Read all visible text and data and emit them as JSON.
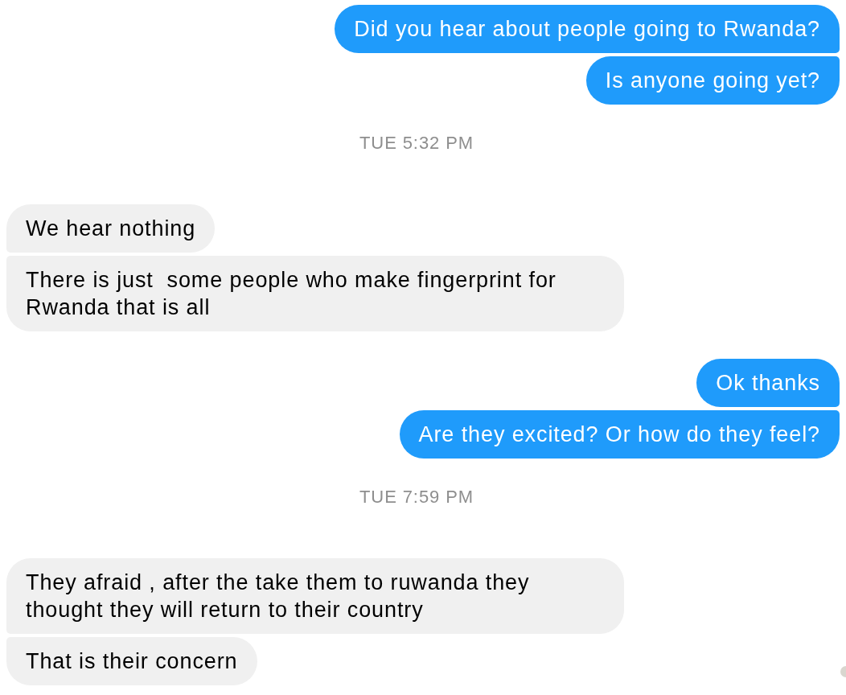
{
  "conversation": [
    {
      "kind": "outgoing",
      "messages": [
        "Did you hear about people going to Rwanda?",
        "Is anyone going yet?"
      ]
    },
    {
      "kind": "timestamp",
      "text": "TUE 5:32 PM"
    },
    {
      "kind": "incoming",
      "messages": [
        "We hear nothing",
        "There is just  some people who make fingerprint for Rwanda that is all"
      ]
    },
    {
      "kind": "outgoing",
      "messages": [
        "Ok thanks",
        "Are they excited? Or how do they feel?"
      ]
    },
    {
      "kind": "timestamp",
      "text": "TUE 7:59 PM"
    },
    {
      "kind": "incoming",
      "messages": [
        "They afraid , after the take them to ruwanda they thought they will return to their country",
        "That is their concern"
      ]
    }
  ]
}
